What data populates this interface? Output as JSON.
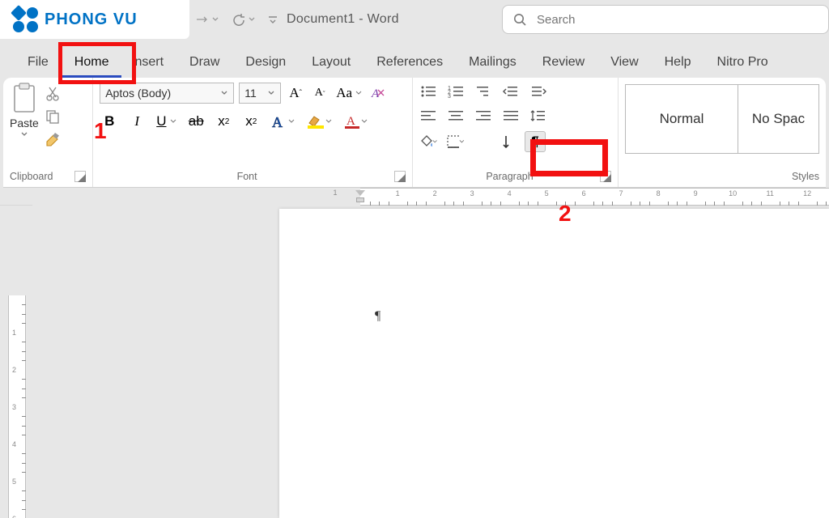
{
  "brand": {
    "text": "PHONG VU"
  },
  "title": "Document1  -  Word",
  "search": {
    "placeholder": "Search"
  },
  "tabs": {
    "file": "File",
    "home": "Home",
    "insert": "nsert",
    "draw": "Draw",
    "design": "Design",
    "layout": "Layout",
    "references": "References",
    "mailings": "Mailings",
    "review": "Review",
    "view": "View",
    "help": "Help",
    "nitro": "Nitro Pro"
  },
  "ribbon": {
    "clipboard": {
      "label": "Clipboard",
      "paste": "Paste"
    },
    "font": {
      "label": "Font",
      "family": "Aptos (Body)",
      "size": "11"
    },
    "paragraph": {
      "label": "Paragraph"
    },
    "styles": {
      "label": "Styles",
      "normal": "Normal",
      "nospacing": "No Spac"
    }
  },
  "annotations": {
    "one": "1",
    "two": "2"
  },
  "doc": {
    "mark": "¶"
  }
}
